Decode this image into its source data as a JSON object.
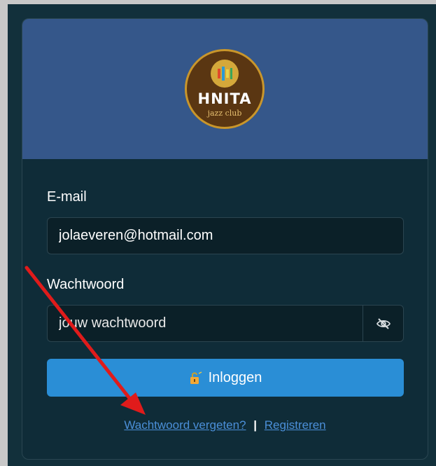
{
  "logo": {
    "name": "HNITA",
    "subtitle": "jazz club"
  },
  "form": {
    "email_label": "E-mail",
    "email_value": "jolaeveren@hotmail.com",
    "password_label": "Wachtwoord",
    "password_placeholder": "jouw wachtwoord",
    "login_label": "Inloggen"
  },
  "links": {
    "forgot": "Wachtwoord vergeten?",
    "separator": "|",
    "register": "Registreren"
  },
  "colors": {
    "header": "#35578a",
    "card": "#0f2c38",
    "button": "#2a8ed6",
    "link": "#4b8fd8",
    "annotation_arrow": "#e01b1b"
  },
  "icons": {
    "password_toggle": "eye-slash-icon",
    "login": "lock-icon",
    "annotation": "red-arrow"
  }
}
